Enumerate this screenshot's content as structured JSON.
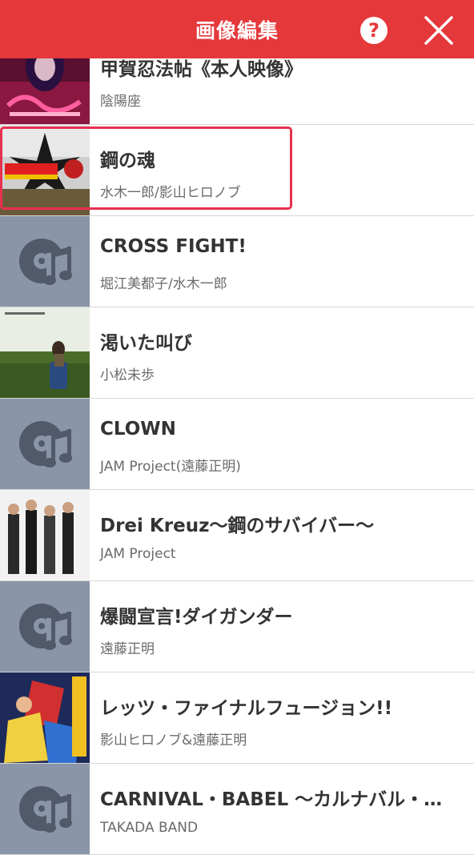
{
  "header": {
    "title": "画像編集",
    "help": "?"
  },
  "colors": {
    "header": "#e5383b",
    "highlight": "#e8304f",
    "placeholder": "#8a95a8"
  },
  "songs": [
    {
      "title": "甲賀忍法帖《本人映像》",
      "artist": "陰陽座",
      "art": "anime"
    },
    {
      "title": "鋼の魂",
      "artist": "水木一郎/影山ヒロノブ",
      "art": "robot",
      "selected": true
    },
    {
      "title": "CROSS FIGHT!",
      "artist": "堀江美都子/水木一郎",
      "art": "music-icon"
    },
    {
      "title": "渇いた叫び",
      "artist": "小松未歩",
      "art": "field"
    },
    {
      "title": "CLOWN",
      "artist": "JAM Project(遠藤正明)",
      "art": "music-icon"
    },
    {
      "title": "Drei Kreuz〜鋼のサバイバー〜",
      "artist": "JAM Project",
      "art": "band"
    },
    {
      "title": "爆闘宣言!ダイガンダー",
      "artist": "遠藤正明",
      "art": "music-icon"
    },
    {
      "title": "レッツ・ファイナルフュージョン!!",
      "artist": "影山ヒロノブ&遠藤正明",
      "art": "gaogaigar"
    },
    {
      "title": "CARNIVAL・BABEL 〜カルナバル・…",
      "artist": "TAKADA BAND",
      "art": "music-icon"
    }
  ]
}
